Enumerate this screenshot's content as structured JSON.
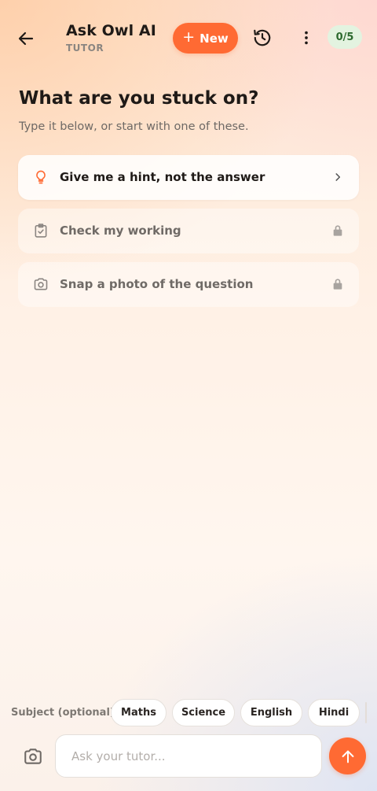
{
  "header": {
    "title": "Ask Owl AI",
    "subtitle": "TUTOR",
    "new_button_label": "New",
    "quota_badge": "0/5",
    "icons": {
      "back": "arrow-left-icon",
      "new": "plus-icon",
      "history": "history-icon",
      "more": "more-vertical-icon"
    }
  },
  "intro": {
    "heading": "What are you stuck on?",
    "subheading": "Type it below, or start with one of these."
  },
  "suggestions": [
    {
      "label": "Give me a hint, not the answer",
      "icon": "lightbulb-icon",
      "trailing": "chevron-right-icon",
      "locked": false
    },
    {
      "label": "Check my working",
      "icon": "clipboard-check-icon",
      "trailing": "lock-icon",
      "locked": true
    },
    {
      "label": "Snap a photo of the question",
      "icon": "camera-icon",
      "trailing": "lock-icon",
      "locked": true
    }
  ],
  "subjects": {
    "label": "Subject (optional)",
    "options": [
      "Maths",
      "Science",
      "English",
      "Hindi"
    ]
  },
  "composer": {
    "placeholder": "Ask your tutor...",
    "camera_icon": "camera-icon",
    "send_icon": "arrow-up-icon"
  },
  "colors": {
    "accent": "#ff6a33",
    "badge_bg": "#e3f3e0",
    "badge_text": "#2d6a2f"
  }
}
